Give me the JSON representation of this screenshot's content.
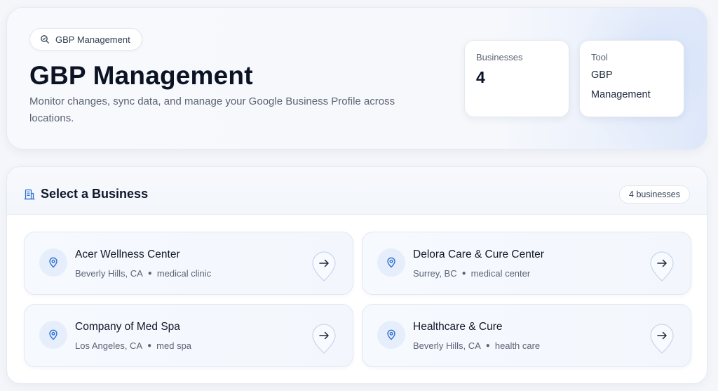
{
  "header": {
    "pill_label": "GBP Management",
    "pill_icon": "search-icon",
    "title": "GBP Management",
    "description": "Monitor changes, sync data, and manage your Google Business Profile across locations."
  },
  "stats": {
    "businesses_label": "Businesses",
    "businesses_value": "4",
    "tool_label": "Tool",
    "tool_value_line1": "GBP",
    "tool_value_line2": "Management"
  },
  "panel": {
    "title": "Select a Business",
    "title_icon": "building-icon",
    "count_label": "4 businesses"
  },
  "businesses": [
    {
      "name": "Acer Wellness Center",
      "location": "Beverly Hills, CA",
      "category": "medical clinic"
    },
    {
      "name": "Delora Care & Cure Center",
      "location": "Surrey, BC",
      "category": "medical center"
    },
    {
      "name": "Company of Med Spa",
      "location": "Los Angeles, CA",
      "category": "med spa"
    },
    {
      "name": "Healthcare & Cure",
      "location": "Beverly Hills, CA",
      "category": "health care"
    }
  ],
  "colors": {
    "accent": "#2f6fd6",
    "text_primary": "#0b1324",
    "text_muted": "#5b6475"
  }
}
